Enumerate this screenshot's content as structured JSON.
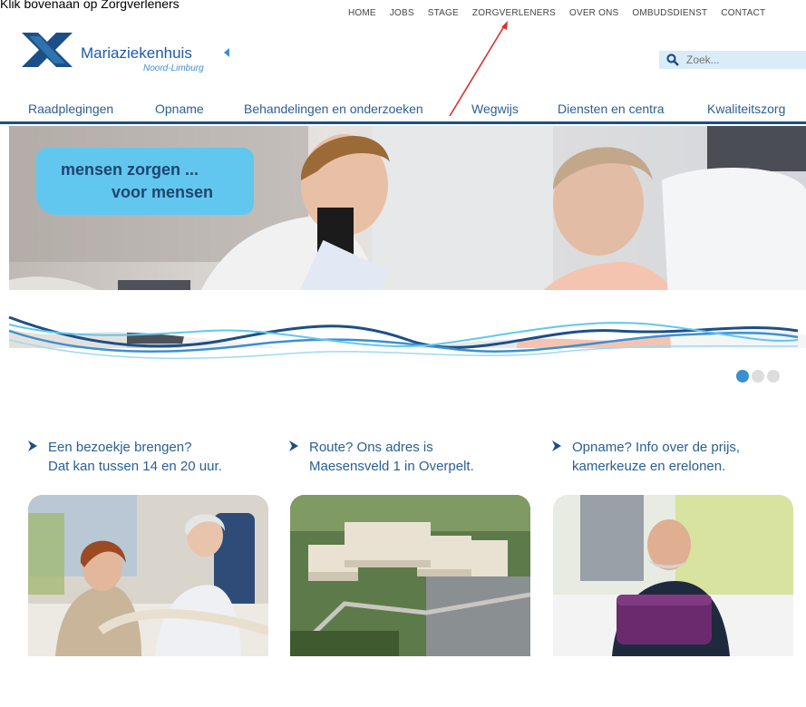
{
  "instruction": "Klik bovenaan op Zorgverleners",
  "top_nav": [
    "HOME",
    "JOBS",
    "STAGE",
    "ZORGVERLENERS",
    "OVER ONS",
    "OMBUDSDIENST",
    "CONTACT"
  ],
  "logo": {
    "name": "Mariaziekenhuis",
    "sub": "Noord-Limburg"
  },
  "search": {
    "placeholder": "Zoek..."
  },
  "main_nav": [
    "Raadplegingen",
    "Opname",
    "Behandelingen en onderzoeken",
    "Wegwijs",
    "Diensten en centra",
    "Kwaliteitszorg"
  ],
  "hero": {
    "line1": "mensen zorgen ...",
    "line2": "voor mensen"
  },
  "teasers": [
    {
      "line1": "Een bezoekje brengen?",
      "line2": "Dat kan tussen 14 en 20 uur."
    },
    {
      "line1": "Route? Ons adres is",
      "line2": "Maesensveld 1 in Overpelt."
    },
    {
      "line1": "Opname? Info over de prijs,",
      "line2": "kamerkeuze en erelonen."
    }
  ],
  "colors": {
    "brand_blue": "#1d5aa8",
    "light_blue": "#62c7ee",
    "nav_blue": "#2a5f94",
    "annotation_red": "#d8322e"
  }
}
